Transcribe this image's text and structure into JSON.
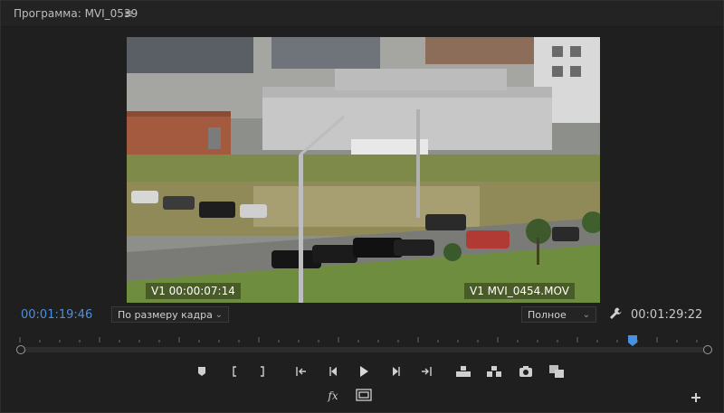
{
  "panel": {
    "title": "Программа: MVI_0539",
    "menu_icon": "hamburger-menu-icon"
  },
  "video": {
    "overlay_left": "V1 00:00:07:14",
    "overlay_right": "V1 MVI_0454.MOV"
  },
  "timecodes": {
    "current": "00:01:19:46",
    "duration": "00:01:29:22"
  },
  "controls": {
    "fit_select": {
      "value": "По размеру кадра"
    },
    "quality_select": {
      "value": "Полное"
    },
    "settings_icon": "wrench-icon"
  },
  "timeline": {
    "playhead_fraction": 0.892
  },
  "transport": {
    "buttons": [
      "add-marker-icon",
      "mark-in-icon",
      "mark-out-icon",
      "go-to-in-icon",
      "step-back-icon",
      "play-icon",
      "step-forward-icon",
      "go-to-out-icon",
      "lift-icon",
      "extract-icon",
      "export-frame-icon",
      "comparison-view-icon"
    ],
    "second_row": [
      "fx-icon",
      "safe-margins-icon"
    ],
    "add_button_icon": "plus-icon"
  },
  "colors": {
    "accent": "#4a90e2",
    "panel_bg": "#1f1f1f",
    "text": "#c8c8c8"
  }
}
